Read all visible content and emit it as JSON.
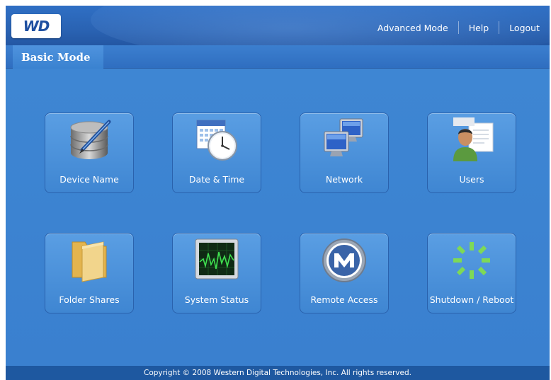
{
  "header": {
    "logo_text": "WD",
    "nav": {
      "advanced_mode": "Advanced Mode",
      "help": "Help",
      "logout": "Logout"
    }
  },
  "tab": {
    "label": "Basic Mode"
  },
  "tiles": [
    {
      "label": "Device Name",
      "icon": "database-pen-icon"
    },
    {
      "label": "Date & Time",
      "icon": "calendar-clock-icon"
    },
    {
      "label": "Network",
      "icon": "network-computers-icon"
    },
    {
      "label": "Users",
      "icon": "user-icon"
    },
    {
      "label": "Folder Shares",
      "icon": "folder-icon"
    },
    {
      "label": "System Status",
      "icon": "monitor-graph-icon"
    },
    {
      "label": "Remote Access",
      "icon": "mionet-icon"
    },
    {
      "label": "Shutdown / Reboot",
      "icon": "power-spinner-icon"
    }
  ],
  "footer": {
    "text": "Copyright © 2008 Western Digital Technologies, Inc. All rights reserved."
  },
  "colors": {
    "background": "#3a82d0",
    "header": "#2a63b3",
    "footer": "#1e58a0",
    "spinner": "#7ed957"
  }
}
